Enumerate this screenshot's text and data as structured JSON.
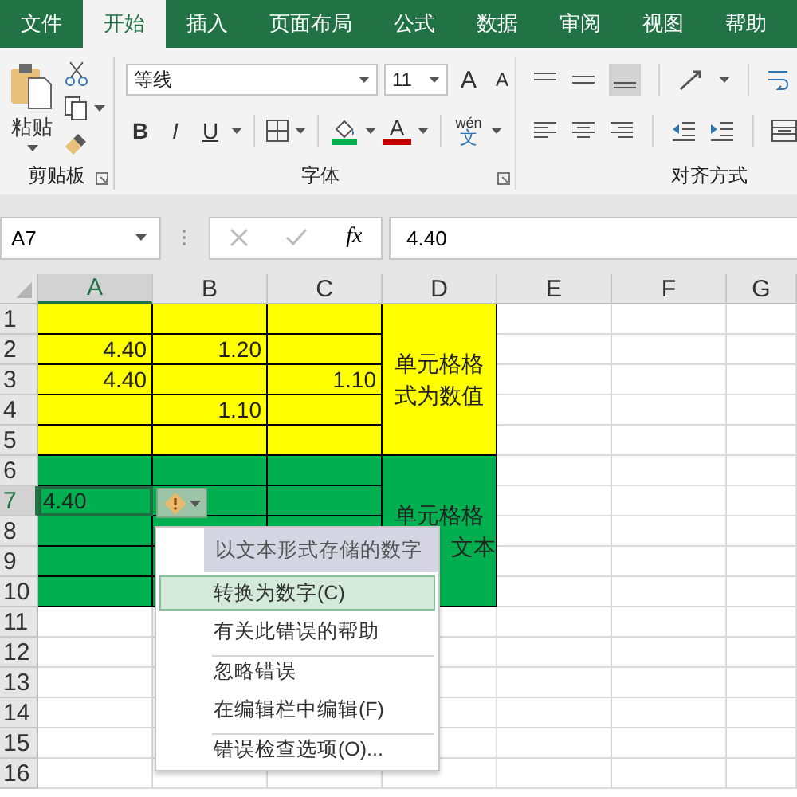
{
  "tabs": [
    {
      "label": "文件",
      "selected": false
    },
    {
      "label": "开始",
      "selected": true
    },
    {
      "label": "插入",
      "selected": false
    },
    {
      "label": "页面布局",
      "selected": false
    },
    {
      "label": "公式",
      "selected": false
    },
    {
      "label": "数据",
      "selected": false
    },
    {
      "label": "审阅",
      "selected": false
    },
    {
      "label": "视图",
      "selected": false
    },
    {
      "label": "帮助",
      "selected": false
    }
  ],
  "ribbon": {
    "clipboard": {
      "paste_label": "粘贴",
      "group_label": "剪贴板"
    },
    "font": {
      "font_name": "等线",
      "font_size": "11",
      "grow_label": "A",
      "shrink_label": "A",
      "bold_label": "B",
      "italic_label": "I",
      "underline_label": "U",
      "font_color_label": "A",
      "phonetic_top": "wén",
      "phonetic_bottom": "文",
      "group_label": "字体"
    },
    "alignment": {
      "group_label": "对齐方式"
    }
  },
  "formula_bar": {
    "name_box": "A7",
    "function_label": "fx",
    "value": "4.40"
  },
  "sheet": {
    "columns": [
      {
        "label": "A",
        "selected": true
      },
      {
        "label": "B",
        "selected": false
      },
      {
        "label": "C",
        "selected": false
      },
      {
        "label": "D",
        "selected": false
      },
      {
        "label": "E",
        "selected": false
      },
      {
        "label": "F",
        "selected": false
      },
      {
        "label": "G",
        "selected": false
      }
    ],
    "rows": [
      {
        "header": "1",
        "selected": false,
        "color": "#ffff00",
        "merged_text": [
          {
            "text": "单元格格",
            "cut_start": false
          },
          {
            "text": "式为数值",
            "cut_start": false
          }
        ],
        "cells": []
      },
      {
        "header": "2",
        "selected": false,
        "color": "#ffff00",
        "cells": {
          "A": {
            "value": "4.40",
            "kind": "number",
            "selected": false
          },
          "B": {
            "value": "1.20",
            "kind": "number",
            "selected": false
          }
        }
      },
      {
        "header": "3",
        "selected": false,
        "color": "#ffff00",
        "cells": {
          "A": {
            "value": "4.40",
            "kind": "number",
            "selected": false
          },
          "C": {
            "value": "1.10",
            "kind": "number",
            "selected": false
          }
        }
      },
      {
        "header": "4",
        "selected": false,
        "color": "#ffff00",
        "cells": {
          "B": {
            "value": "1.10",
            "kind": "number",
            "selected": false
          }
        }
      },
      {
        "header": "5",
        "selected": false,
        "color": "#ffff00",
        "cells": []
      },
      {
        "header": "6",
        "selected": false,
        "color": "#00b050",
        "merged_text": [
          {
            "text": "单元格格",
            "cut_start": false
          },
          {
            "text": "文本",
            "cut_start": true
          }
        ],
        "cells": []
      },
      {
        "header": "7",
        "selected": true,
        "color": "#00b050",
        "cells": {
          "A": {
            "value": "4.40",
            "kind": "text",
            "selected": true
          }
        }
      },
      {
        "header": "8",
        "selected": false,
        "color": "#00b050",
        "cells": []
      },
      {
        "header": "9",
        "selected": false,
        "color": "#00b050",
        "cells": []
      },
      {
        "header": "10",
        "selected": false,
        "color": "#00b050",
        "cells": []
      },
      {
        "header": "11",
        "selected": false,
        "cells": []
      },
      {
        "header": "12",
        "selected": false,
        "cells": []
      },
      {
        "header": "13",
        "selected": false,
        "cells": []
      },
      {
        "header": "14",
        "selected": false,
        "cells": []
      },
      {
        "header": "15",
        "selected": false,
        "cells": []
      },
      {
        "header": "16",
        "selected": false,
        "cells": []
      }
    ]
  },
  "error_menu": {
    "title": "以文本形式存储的数字",
    "items": [
      {
        "label": "转换为数字(C)",
        "selected": true,
        "separator_before": false
      },
      {
        "label": "有关此错误的帮助",
        "selected": false,
        "separator_before": false
      },
      {
        "label": "忽略错误",
        "selected": false,
        "separator_before": true
      },
      {
        "label": "在编辑栏中编辑(F)",
        "selected": false,
        "separator_before": false
      },
      {
        "label": "错误检查选项(O)...",
        "selected": false,
        "separator_before": true
      }
    ]
  }
}
